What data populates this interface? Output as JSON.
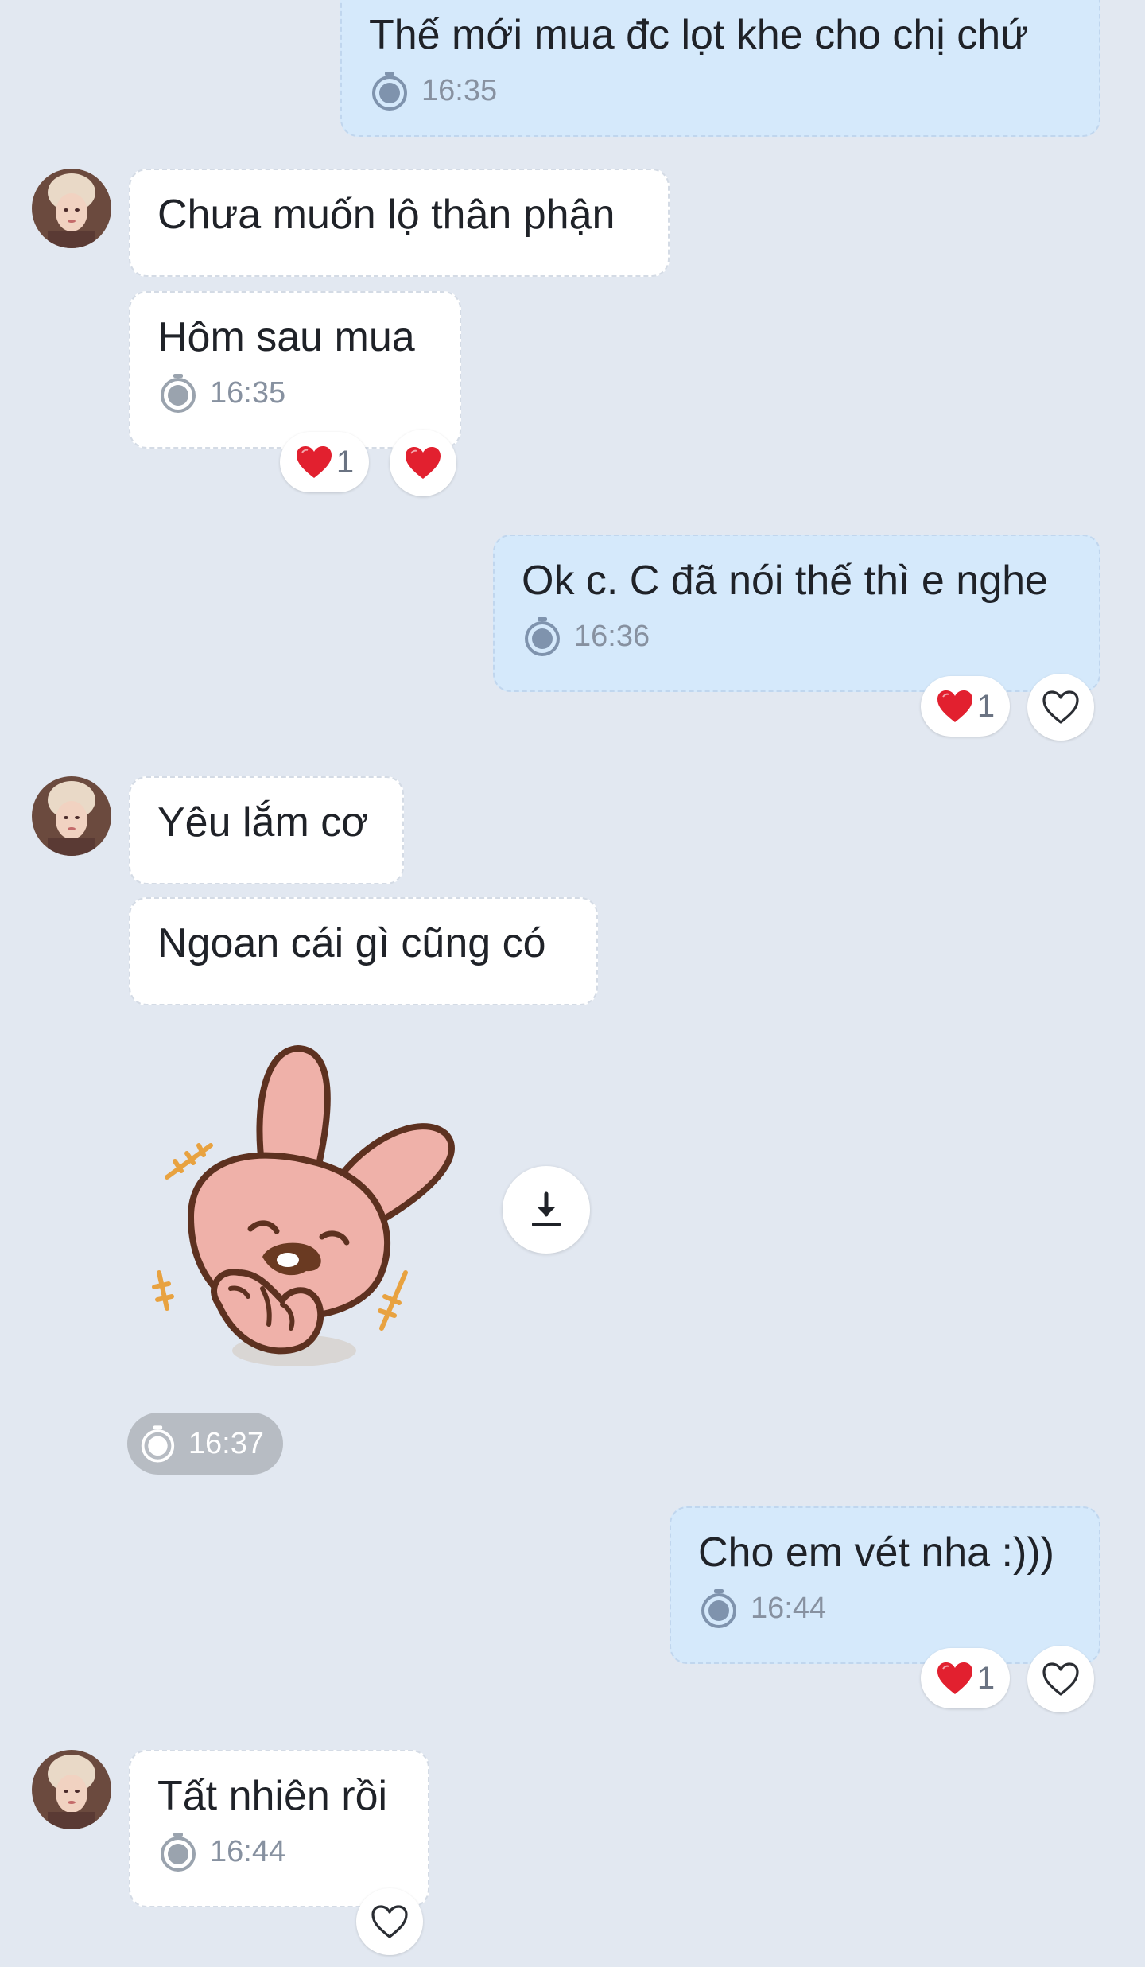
{
  "colors": {
    "background": "#e2e8f1",
    "incoming_bubble": "#ffffff",
    "outgoing_bubble": "#d5e9fb",
    "reaction_heart": "#e2202f",
    "meta_text": "#8791a0"
  },
  "messages": [
    {
      "direction": "outgoing",
      "text": "Thế mới mua đc lọt khe cho chị chứ",
      "time": "16:35"
    },
    {
      "direction": "incoming",
      "text": "Chưa muốn lộ thân phận"
    },
    {
      "direction": "incoming",
      "text": "Hôm sau mua",
      "time": "16:35",
      "reaction_count": "1"
    },
    {
      "direction": "outgoing",
      "text": "Ok c. C đã nói thế thì e nghe",
      "time": "16:36",
      "reaction_count": "1"
    },
    {
      "direction": "incoming",
      "text": "Yêu lắm cơ"
    },
    {
      "direction": "incoming",
      "text": "Ngoan cái gì cũng có"
    },
    {
      "direction": "incoming",
      "type": "sticker",
      "sticker": "pink-bunny-sticker",
      "time": "16:37"
    },
    {
      "direction": "outgoing",
      "text": "Cho em vét nha :)))",
      "time": "16:44",
      "reaction_count": "1"
    },
    {
      "direction": "incoming",
      "text": "Tất nhiên rồi",
      "time": "16:44"
    }
  ],
  "icons": {
    "clock": "stopwatch-icon",
    "reaction": "heart-icon",
    "react_button": "heart-outline-icon",
    "download": "download-icon"
  }
}
